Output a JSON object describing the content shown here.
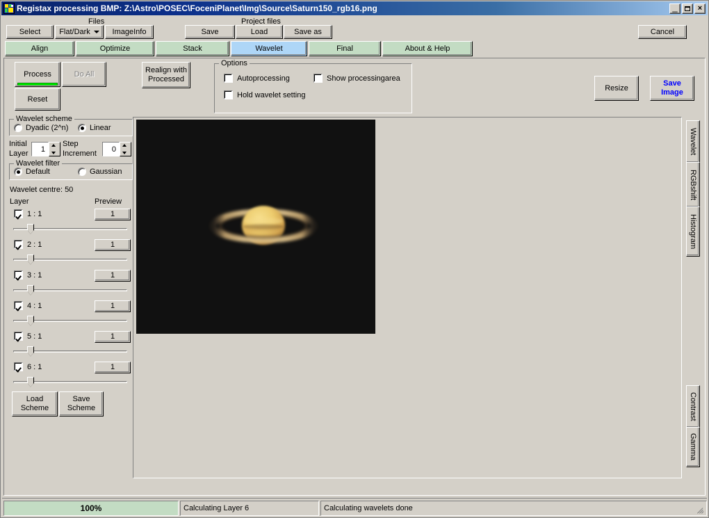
{
  "window": {
    "title": "Registax processing  BMP: Z:\\Astro\\POSEC\\FoceniPlanet\\Img\\Source\\Saturn150_rgb16.png",
    "minimize": "_",
    "maximize": "",
    "close": "×"
  },
  "toolbar": {
    "files_label": "Files",
    "project_label": "Project files",
    "select": "Select",
    "flat_dark": "Flat/Dark",
    "image_info": "ImageInfo",
    "save": "Save",
    "load": "Load",
    "save_as": "Save as",
    "cancel": "Cancel"
  },
  "tabs": [
    {
      "label": "Align",
      "active": false
    },
    {
      "label": "Optimize",
      "active": false
    },
    {
      "label": "Stack",
      "active": false
    },
    {
      "label": "Wavelet",
      "active": true
    },
    {
      "label": "Final",
      "active": false
    },
    {
      "label": "About & Help",
      "active": false
    }
  ],
  "actions": {
    "process": "Process",
    "do_all": "Do All",
    "reset": "Reset",
    "realign_line1": "Realign with",
    "realign_line2": "Processed",
    "resize": "Resize",
    "save_image_line1": "Save",
    "save_image_line2": "Image",
    "save_image_color": "#0000ff",
    "process_bar_color": "#00ff00"
  },
  "options": {
    "title": "Options",
    "autoprocessing": {
      "label": "Autoprocessing",
      "checked": false
    },
    "hold_wavelet": {
      "label": "Hold wavelet setting",
      "checked": false
    },
    "show_area": {
      "label": "Show processingarea",
      "checked": false
    }
  },
  "wavelet_scheme": {
    "title": "Wavelet scheme",
    "dyadic": {
      "label": "Dyadic (2^n)",
      "selected": false
    },
    "linear": {
      "label": "Linear",
      "selected": true
    },
    "initial_layer_label_1": "Initial",
    "initial_layer_label_2": "Layer",
    "initial_layer_value": "1",
    "step_increment_label_1": "Step",
    "step_increment_label_2": "Increment",
    "step_increment_value": "0"
  },
  "wavelet_filter": {
    "title": "Wavelet filter",
    "default": {
      "label": "Default",
      "selected": true
    },
    "gaussian": {
      "label": "Gaussian",
      "selected": false
    }
  },
  "wavelet_centre": "Wavelet centre: 50",
  "layer_headers": {
    "layer": "Layer",
    "preview": "Preview"
  },
  "layers": [
    {
      "label": "1 : 1",
      "checked": true,
      "preview": "1",
      "slider_pct": 4
    },
    {
      "label": "2 : 1",
      "checked": true,
      "preview": "1",
      "slider_pct": 4
    },
    {
      "label": "3 : 1",
      "checked": true,
      "preview": "1",
      "slider_pct": 4
    },
    {
      "label": "4 : 1",
      "checked": true,
      "preview": "1",
      "slider_pct": 4
    },
    {
      "label": "5 : 1",
      "checked": true,
      "preview": "1",
      "slider_pct": 4
    },
    {
      "label": "6 : 1",
      "checked": true,
      "preview": "1",
      "slider_pct": 4
    }
  ],
  "scheme_buttons": {
    "load_line1": "Load",
    "load_line2": "Scheme",
    "save_line1": "Save",
    "save_line2": "Scheme"
  },
  "side_tabs_top": [
    {
      "label": "Wavelet"
    },
    {
      "label": "RGBshift"
    },
    {
      "label": "Histogram"
    }
  ],
  "side_tabs_bottom": [
    {
      "label": "Contrast"
    },
    {
      "label": "Gamma"
    }
  ],
  "status": {
    "progress": "100%",
    "message1": "Calculating Layer 6",
    "message2": "Calculating wavelets done"
  },
  "image": {
    "background": "#111111",
    "planet_body": "#e8c86a",
    "ring": "#c9a46e"
  }
}
